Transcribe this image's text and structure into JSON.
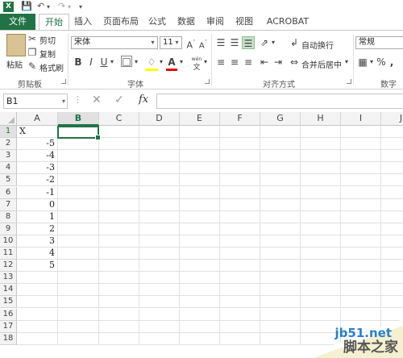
{
  "qat": {
    "save_icon": "save-icon",
    "undo_icon": "undo-icon",
    "redo_icon": "redo-icon",
    "customize_icon": "customize-icon"
  },
  "tabs": [
    "文件",
    "开始",
    "插入",
    "页面布局",
    "公式",
    "数据",
    "审阅",
    "视图",
    "ACROBAT"
  ],
  "clipboard": {
    "paste": "粘贴",
    "cut": "剪切",
    "copy": "复制",
    "painter": "格式刷",
    "label": "剪贴板"
  },
  "font": {
    "name": "宋体",
    "size": "11",
    "bold": "B",
    "italic": "I",
    "underline": "U",
    "grow": "A",
    "shrink": "A",
    "label": "字体",
    "wen": "wén"
  },
  "alignment": {
    "wrap": "自动换行",
    "merge": "合并后居中",
    "label": "对齐方式"
  },
  "number": {
    "format": "常规",
    "percent": "%",
    "comma": ",",
    "label": "数字"
  },
  "formula_bar": {
    "name_box": "B1",
    "fx": "fx",
    "value": ""
  },
  "columns": [
    "A",
    "B",
    "C",
    "D",
    "E",
    "F",
    "G",
    "H",
    "I",
    "J"
  ],
  "rows": [
    "1",
    "2",
    "3",
    "4",
    "5",
    "6",
    "7",
    "8",
    "9",
    "10",
    "11",
    "12",
    "13",
    "14",
    "15",
    "16",
    "17",
    "18"
  ],
  "cells_a": [
    "X",
    "-5",
    "-4",
    "-3",
    "-2",
    "-1",
    "0",
    "1",
    "2",
    "3",
    "4",
    "5"
  ],
  "watermark": {
    "url": "jb51.net",
    "text": "脚本之家"
  }
}
